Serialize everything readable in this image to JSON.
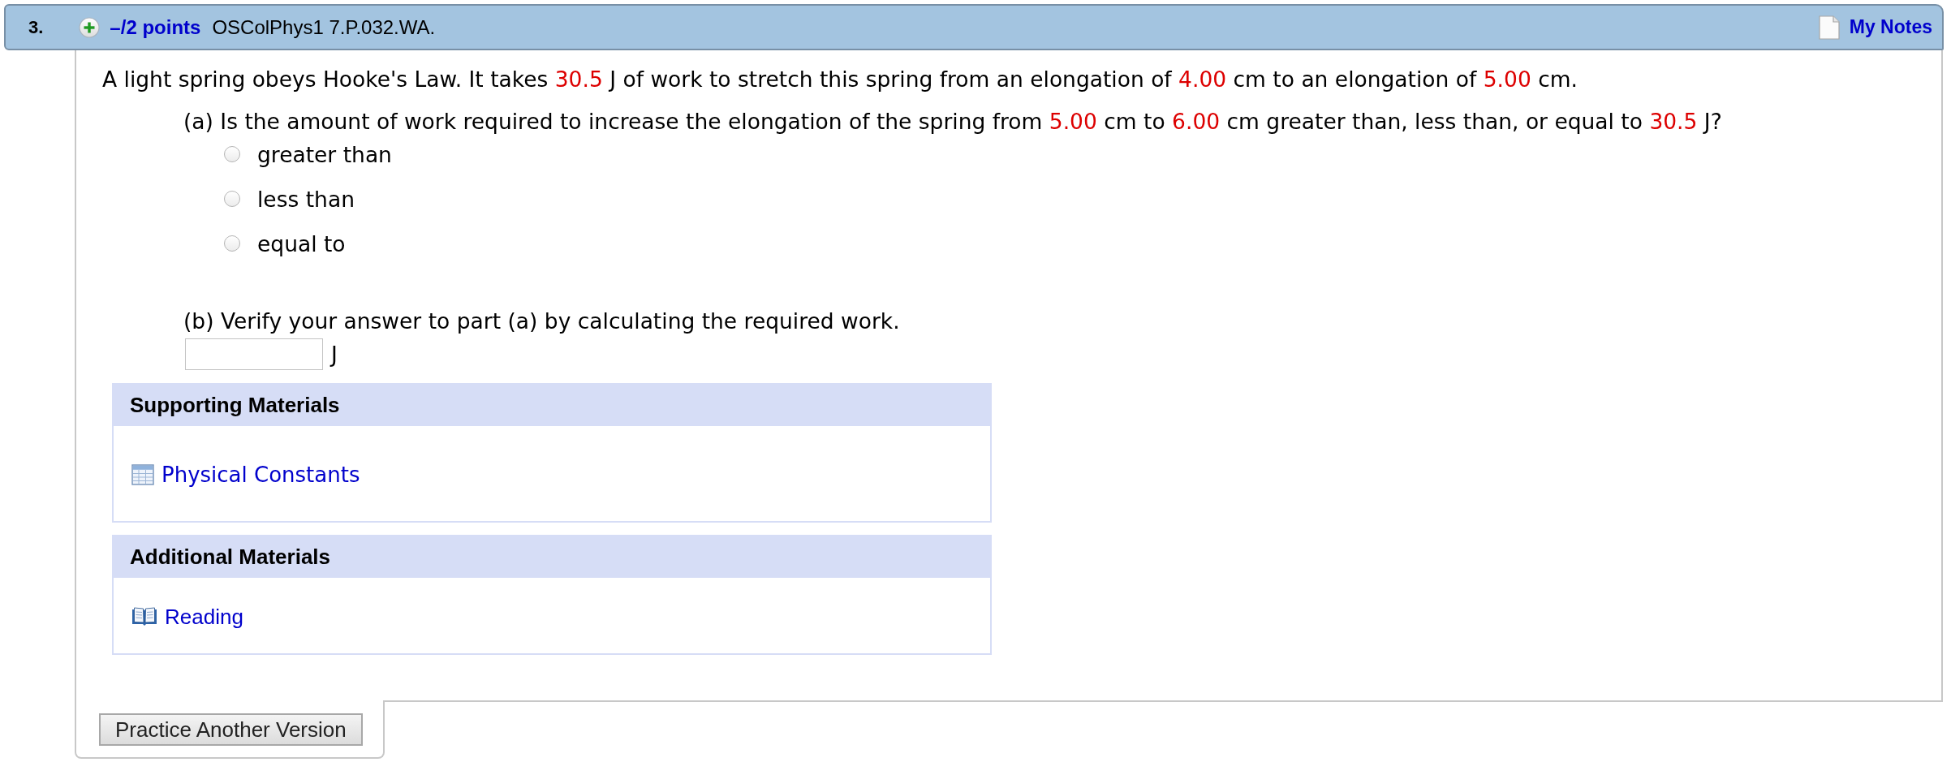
{
  "question": {
    "number": "3.",
    "points": "–/2 points",
    "code": "OSColPhys1 7.P.032.WA.",
    "notes": "My Notes"
  },
  "statement": [
    {
      "kind": "text",
      "text": "A light spring obeys Hooke's Law. It takes "
    },
    {
      "kind": "value",
      "text": "30.5"
    },
    {
      "kind": "text",
      "text": " J of work to stretch this spring from an elongation of "
    },
    {
      "kind": "value",
      "text": "4.00"
    },
    {
      "kind": "text",
      "text": " cm to an elongation of "
    },
    {
      "kind": "value",
      "text": "5.00"
    },
    {
      "kind": "text",
      "text": " cm."
    }
  ],
  "parts": [
    {
      "kind": "choice",
      "prompt": [
        {
          "kind": "text",
          "text": "(a) Is the amount of work required to increase the elongation of the spring from "
        },
        {
          "kind": "value",
          "text": "5.00"
        },
        {
          "kind": "text",
          "text": " cm to "
        },
        {
          "kind": "value",
          "text": "6.00"
        },
        {
          "kind": "text",
          "text": " cm greater than, less than, or equal to "
        },
        {
          "kind": "value",
          "text": "30.5"
        },
        {
          "kind": "text",
          "text": " J?"
        }
      ],
      "options": [
        {
          "label": "greater than",
          "selected": false
        },
        {
          "label": "less than",
          "selected": false
        },
        {
          "label": "equal to",
          "selected": false
        }
      ]
    },
    {
      "kind": "answer",
      "prompt": [
        {
          "kind": "text",
          "text": "(b) Verify your answer to part (a) by calculating the required work."
        }
      ],
      "unit": "J"
    }
  ],
  "materials": [
    {
      "title": "Supporting Materials",
      "links": [
        {
          "kind": "table",
          "label": "Physical Constants"
        }
      ]
    },
    {
      "title": "Additional Materials",
      "links": [
        {
          "kind": "book",
          "label": "Reading"
        }
      ]
    }
  ],
  "footer": {
    "button": "Practice Another Version"
  }
}
